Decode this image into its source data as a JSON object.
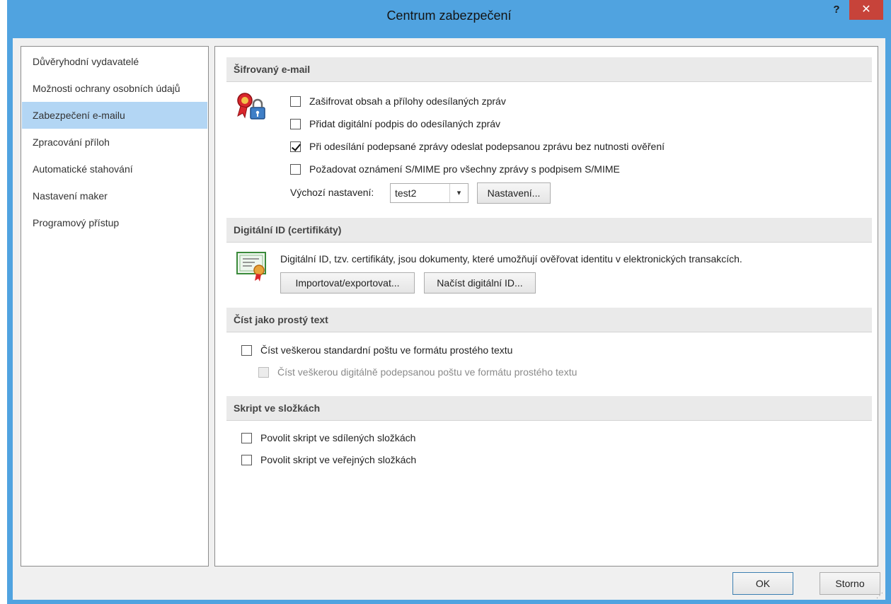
{
  "window": {
    "title": "Centrum zabezpečení",
    "help_label": "?",
    "close_label": "✕"
  },
  "sidebar": {
    "items": [
      {
        "label": "Důvěryhodní vydavatelé",
        "selected": false
      },
      {
        "label": "Možnosti ochrany osobních údajů",
        "selected": false
      },
      {
        "label": "Zabezpečení e-mailu",
        "selected": true
      },
      {
        "label": "Zpracování příloh",
        "selected": false
      },
      {
        "label": "Automatické stahování",
        "selected": false
      },
      {
        "label": "Nastavení maker",
        "selected": false
      },
      {
        "label": "Programový přístup",
        "selected": false
      }
    ]
  },
  "encrypted_email": {
    "heading": "Šifrovaný e-mail",
    "options": [
      {
        "label": "Zašifrovat obsah a přílohy odesílaných zpráv",
        "checked": false
      },
      {
        "label": "Přidat digitální podpis do odesílaných zpráv",
        "checked": false
      },
      {
        "label": "Při odesílání podepsané zprávy odeslat podepsanou zprávu bez nutnosti ověření",
        "checked": true
      },
      {
        "label": "Požadovat oznámení S/MIME pro všechny zprávy s podpisem S/MIME",
        "checked": false
      }
    ],
    "default_setting_label": "Výchozí nastavení:",
    "default_setting_value": "test2",
    "settings_button": "Nastavení..."
  },
  "digital_id": {
    "heading": "Digitální ID (certifikáty)",
    "description": "Digitální ID, tzv. certifikáty, jsou dokumenty, které umožňují ověřovat identitu v elektronických transakcích.",
    "import_export_button": "Importovat/exportovat...",
    "get_id_button": "Načíst digitální ID..."
  },
  "plain_text": {
    "heading": "Číst jako prostý text",
    "options": [
      {
        "label": "Číst veškerou standardní poštu ve formátu prostého textu",
        "checked": false,
        "disabled": false
      },
      {
        "label": "Číst veškerou digitálně podepsanou poštu ve formátu prostého textu",
        "checked": false,
        "disabled": true
      }
    ]
  },
  "folder_script": {
    "heading": "Skript ve složkách",
    "options": [
      {
        "label": "Povolit skript ve sdílených složkách",
        "checked": false
      },
      {
        "label": "Povolit skript ve veřejných složkách",
        "checked": false
      }
    ]
  },
  "footer": {
    "ok_button": "OK",
    "cancel_button": "Storno"
  },
  "colors": {
    "title_bar": "#50a3e0",
    "close_button": "#c7433a",
    "selected_item": "#b3d6f4"
  }
}
